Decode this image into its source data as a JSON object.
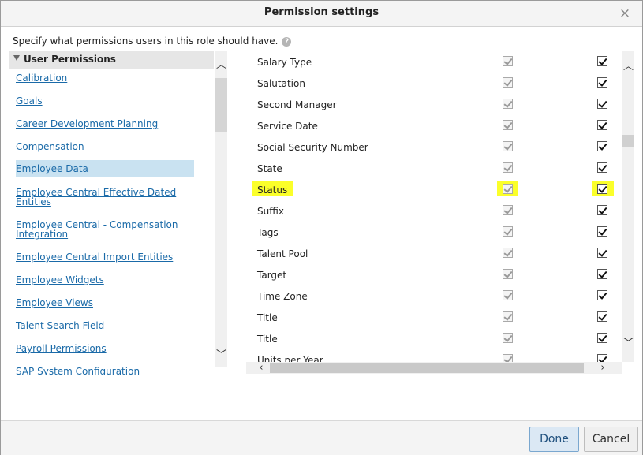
{
  "dialog": {
    "title": "Permission settings",
    "close_glyph": "×",
    "instruction": "Specify what permissions users in this role should have.",
    "help_glyph": "?"
  },
  "left": {
    "header": "User Permissions",
    "items": [
      {
        "label": "Calibration",
        "selected": false
      },
      {
        "label": "Goals",
        "selected": false
      },
      {
        "label": "Career Development Planning",
        "selected": false
      },
      {
        "label": "Compensation",
        "selected": false
      },
      {
        "label": "Employee Data",
        "selected": true
      },
      {
        "label": "Employee Central Effective Dated Entities",
        "selected": false
      },
      {
        "label": "Employee Central - Compensation Integration",
        "selected": false
      },
      {
        "label": "Employee Central Import Entities",
        "selected": false
      },
      {
        "label": "Employee Widgets",
        "selected": false
      },
      {
        "label": "Employee Views",
        "selected": false
      },
      {
        "label": "Talent Search Field",
        "selected": false
      },
      {
        "label": "Payroll Permissions",
        "selected": false
      },
      {
        "label": "SAP System Configuration",
        "selected": false
      }
    ]
  },
  "fields": [
    {
      "name": "Salary Type",
      "view": true,
      "edit": true,
      "highlighted": false
    },
    {
      "name": "Salutation",
      "view": true,
      "edit": true,
      "highlighted": false
    },
    {
      "name": "Second Manager",
      "view": true,
      "edit": true,
      "highlighted": false
    },
    {
      "name": "Service Date",
      "view": true,
      "edit": true,
      "highlighted": false
    },
    {
      "name": "Social Security Number",
      "view": true,
      "edit": true,
      "highlighted": false
    },
    {
      "name": "State",
      "view": true,
      "edit": true,
      "highlighted": false
    },
    {
      "name": "Status",
      "view": true,
      "edit": true,
      "highlighted": true
    },
    {
      "name": "Suffix",
      "view": true,
      "edit": true,
      "highlighted": false
    },
    {
      "name": "Tags",
      "view": true,
      "edit": true,
      "highlighted": false
    },
    {
      "name": "Talent Pool",
      "view": true,
      "edit": true,
      "highlighted": false
    },
    {
      "name": "Target",
      "view": true,
      "edit": true,
      "highlighted": false
    },
    {
      "name": "Time Zone",
      "view": true,
      "edit": true,
      "highlighted": false
    },
    {
      "name": "Title",
      "view": true,
      "edit": true,
      "highlighted": false
    },
    {
      "name": "Title",
      "view": true,
      "edit": true,
      "highlighted": false
    },
    {
      "name": "Units per Year",
      "view": true,
      "edit": true,
      "highlighted": false
    }
  ],
  "footer": {
    "done_label": "Done",
    "cancel_label": "Cancel"
  },
  "colors": {
    "link": "#1a6aa8",
    "selected_bg": "#c9e2f1",
    "highlight": "#fbff2a",
    "primary_button_bg": "#dbe8f4"
  }
}
